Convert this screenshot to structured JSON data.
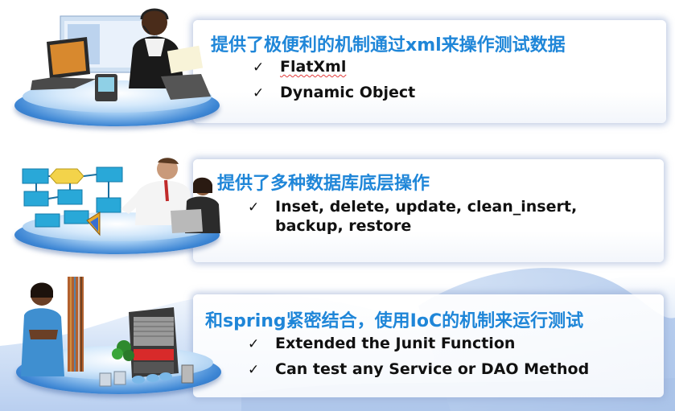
{
  "colors": {
    "heading": "#1f86d8",
    "item_text": "#111111",
    "spellcheck": "#e23b3b",
    "panel_glow": "#96aad2"
  },
  "sections": [
    {
      "heading": "提供了极便利的机制通过xml来操作测试数据",
      "items": [
        "FlatXml",
        "Dynamic Object"
      ],
      "illustration": "laptop-and-call-center-agent-on-platform"
    },
    {
      "heading": "提供了多种数据库底层操作",
      "items": [
        "Inset, delete, update, clean_insert,",
        "backup, restore"
      ],
      "illustration": "flowchart-and-team-on-platform"
    },
    {
      "heading": "和spring紧密结合，使用IoC的机制来运行测试",
      "items": [
        "Extended the Junit Function",
        "Can test any Service or DAO Method"
      ],
      "illustration": "businesswoman-and-server-rack-on-platform"
    }
  ],
  "check_glyph": "✓"
}
